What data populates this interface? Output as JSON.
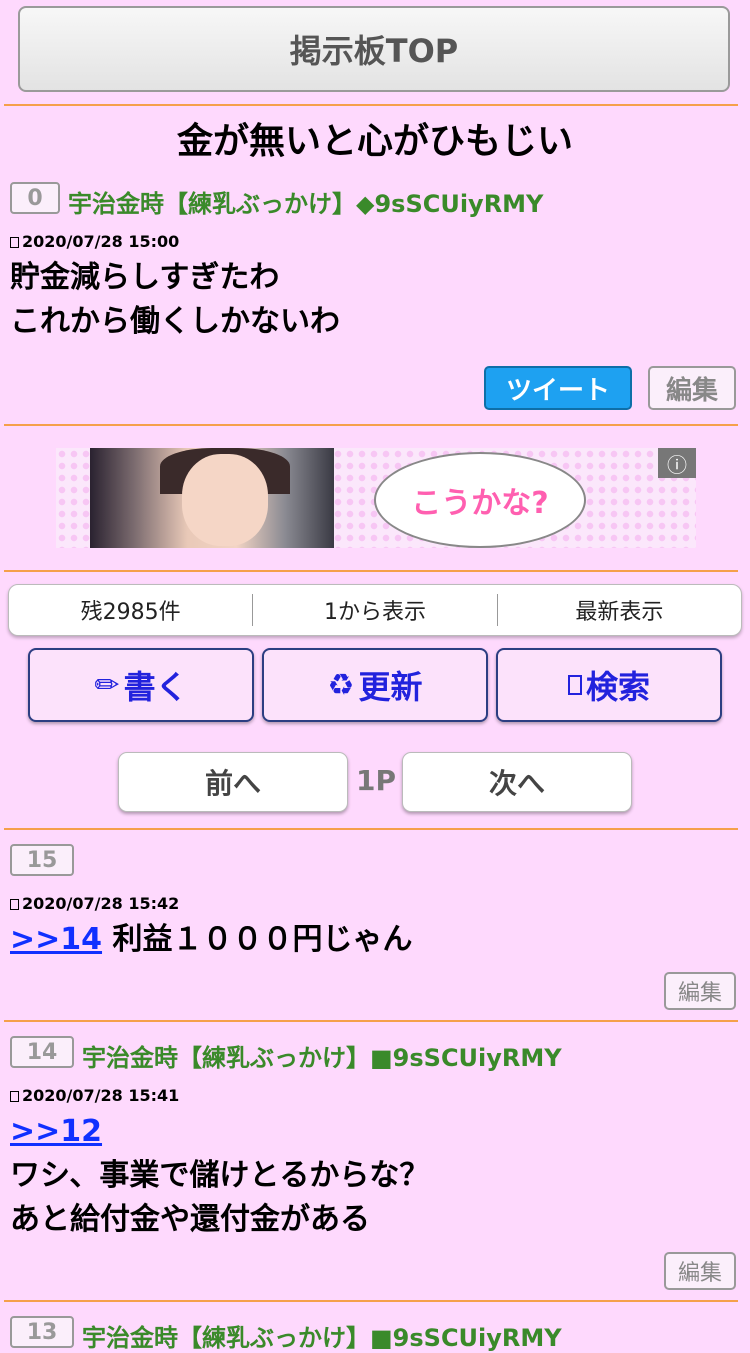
{
  "top_button": "掲示板TOP",
  "thread_title": "金が無いと心がひもじい",
  "op": {
    "number": "0",
    "author": "宇治金時【練乳ぶっかけ】◆9sSCUiyRMY",
    "date": "2020/07/28 15:00",
    "lines": [
      "貯金減らしすぎたわ",
      "これから働くしかないわ"
    ],
    "tweet_label": "ツイート",
    "edit_label": "編集"
  },
  "ad": {
    "bubble_text": "こうかな?",
    "info_icon": "info-icon"
  },
  "stats": {
    "remaining": "残2985件",
    "from_first": "1から表示",
    "latest": "最新表示"
  },
  "actions": {
    "write": "書く",
    "write_icon": "✏",
    "refresh": "更新",
    "refresh_icon": "♻",
    "search": "検索",
    "search_icon": "square-icon"
  },
  "pager": {
    "prev": "前へ",
    "page": "1P",
    "next": "次へ"
  },
  "posts": [
    {
      "number": "15",
      "author": "",
      "date": "2020/07/28 15:42",
      "anchor": ">>14",
      "text": "利益１０００円じゃん",
      "lines": [],
      "edit_label": "編集"
    },
    {
      "number": "14",
      "author": "宇治金時【練乳ぶっかけ】■9sSCUiyRMY",
      "date": "2020/07/28 15:41",
      "anchor": ">>12",
      "text": "",
      "lines": [
        "ワシ、事業で儲けとるからな？",
        "あと給付金や還付金がある"
      ],
      "edit_label": "編集"
    },
    {
      "number": "13",
      "author": "宇治金時【練乳ぶっかけ】■9sSCUiyRMY"
    }
  ],
  "colors": {
    "background": "#fed9fd",
    "divider": "#f5a04a",
    "author": "#3a8a2a",
    "anchor": "#1030ff",
    "tweet": "#1ea1f1",
    "action_text": "#2222dd"
  }
}
